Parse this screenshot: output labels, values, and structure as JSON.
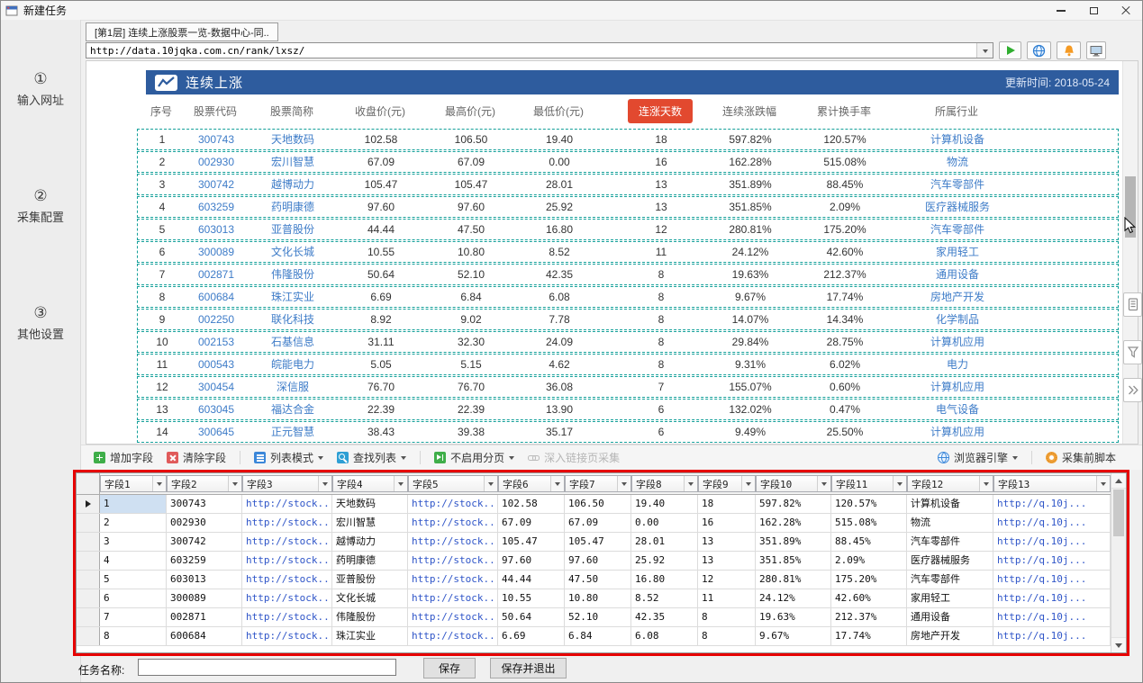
{
  "window": {
    "title": "新建任务"
  },
  "sidebar": {
    "steps": [
      {
        "num": "①",
        "label": "输入网址"
      },
      {
        "num": "②",
        "label": "采集配置"
      },
      {
        "num": "③",
        "label": "其他设置"
      }
    ]
  },
  "tab": {
    "label": "[第1层] 连续上涨股票一览-数据中心-同.."
  },
  "urlbar": {
    "url": "http://data.10jqka.com.cn/rank/lxsz/"
  },
  "browser": {
    "site_title": "连续上涨",
    "update_time": "更新时间: 2018-05-24",
    "table": {
      "headers": [
        "序号",
        "股票代码",
        "股票简称",
        "收盘价(元)",
        "最高价(元)",
        "最低价(元)",
        "连涨天数",
        "连续涨跌幅",
        "累计换手率",
        "所属行业"
      ],
      "rows": [
        [
          "1",
          "300743",
          "天地数码",
          "102.58",
          "106.50",
          "19.40",
          "18",
          "597.82%",
          "120.57%",
          "计算机设备"
        ],
        [
          "2",
          "002930",
          "宏川智慧",
          "67.09",
          "67.09",
          "0.00",
          "16",
          "162.28%",
          "515.08%",
          "物流"
        ],
        [
          "3",
          "300742",
          "越博动力",
          "105.47",
          "105.47",
          "28.01",
          "13",
          "351.89%",
          "88.45%",
          "汽车零部件"
        ],
        [
          "4",
          "603259",
          "药明康德",
          "97.60",
          "97.60",
          "25.92",
          "13",
          "351.85%",
          "2.09%",
          "医疗器械服务"
        ],
        [
          "5",
          "603013",
          "亚普股份",
          "44.44",
          "47.50",
          "16.80",
          "12",
          "280.81%",
          "175.20%",
          "汽车零部件"
        ],
        [
          "6",
          "300089",
          "文化长城",
          "10.55",
          "10.80",
          "8.52",
          "11",
          "24.12%",
          "42.60%",
          "家用轻工"
        ],
        [
          "7",
          "002871",
          "伟隆股份",
          "50.64",
          "52.10",
          "42.35",
          "8",
          "19.63%",
          "212.37%",
          "通用设备"
        ],
        [
          "8",
          "600684",
          "珠江实业",
          "6.69",
          "6.84",
          "6.08",
          "8",
          "9.67%",
          "17.74%",
          "房地产开发"
        ],
        [
          "9",
          "002250",
          "联化科技",
          "8.92",
          "9.02",
          "7.78",
          "8",
          "14.07%",
          "14.34%",
          "化学制品"
        ],
        [
          "10",
          "002153",
          "石基信息",
          "31.11",
          "32.30",
          "24.09",
          "8",
          "29.84%",
          "28.75%",
          "计算机应用"
        ],
        [
          "11",
          "000543",
          "皖能电力",
          "5.05",
          "5.15",
          "4.62",
          "8",
          "9.31%",
          "6.02%",
          "电力"
        ],
        [
          "12",
          "300454",
          "深信服",
          "76.70",
          "76.70",
          "36.08",
          "7",
          "155.07%",
          "0.60%",
          "计算机应用"
        ],
        [
          "13",
          "603045",
          "福达合金",
          "22.39",
          "22.39",
          "13.90",
          "6",
          "132.02%",
          "0.47%",
          "电气设备"
        ],
        [
          "14",
          "300645",
          "正元智慧",
          "38.43",
          "39.38",
          "35.17",
          "6",
          "9.49%",
          "25.50%",
          "计算机应用"
        ]
      ]
    }
  },
  "toolbar": {
    "left": [
      {
        "name": "add-field-button",
        "icon": "plus-icon",
        "label": "增加字段"
      },
      {
        "name": "clear-fields-button",
        "icon": "clear-icon",
        "label": "清除字段"
      },
      {
        "name": "list-mode-button",
        "icon": "list-mode-icon",
        "label": "列表模式",
        "dropdown": true
      },
      {
        "name": "find-list-button",
        "icon": "find-list-icon",
        "label": "查找列表",
        "dropdown": true
      },
      {
        "name": "pagination-mode-button",
        "icon": "pagination-icon",
        "label": "不启用分页",
        "dropdown": true
      },
      {
        "name": "deep-link-collect-button",
        "icon": "link-icon",
        "label": "深入链接页采集",
        "disabled": true
      }
    ],
    "right": [
      {
        "name": "browser-engine-button",
        "icon": "engine-globe-icon",
        "label": "浏览器引擎",
        "dropdown": true
      },
      {
        "name": "pre-collect-script-button",
        "icon": "script-icon",
        "label": "采集前脚本"
      }
    ]
  },
  "grid": {
    "headers": [
      "字段1",
      "字段2",
      "字段3",
      "字段4",
      "字段5",
      "字段6",
      "字段7",
      "字段8",
      "字段9",
      "字段10",
      "字段11",
      "字段12",
      "字段13"
    ],
    "rows": [
      [
        "1",
        "300743",
        "http://stock...",
        "天地数码",
        "http://stock...",
        "102.58",
        "106.50",
        "19.40",
        "18",
        "597.82%",
        "120.57%",
        "计算机设备",
        "http://q.10j..."
      ],
      [
        "2",
        "002930",
        "http://stock...",
        "宏川智慧",
        "http://stock...",
        "67.09",
        "67.09",
        "0.00",
        "16",
        "162.28%",
        "515.08%",
        "物流",
        "http://q.10j..."
      ],
      [
        "3",
        "300742",
        "http://stock...",
        "越博动力",
        "http://stock...",
        "105.47",
        "105.47",
        "28.01",
        "13",
        "351.89%",
        "88.45%",
        "汽车零部件",
        "http://q.10j..."
      ],
      [
        "4",
        "603259",
        "http://stock...",
        "药明康德",
        "http://stock...",
        "97.60",
        "97.60",
        "25.92",
        "13",
        "351.85%",
        "2.09%",
        "医疗器械服务",
        "http://q.10j..."
      ],
      [
        "5",
        "603013",
        "http://stock...",
        "亚普股份",
        "http://stock...",
        "44.44",
        "47.50",
        "16.80",
        "12",
        "280.81%",
        "175.20%",
        "汽车零部件",
        "http://q.10j..."
      ],
      [
        "6",
        "300089",
        "http://stock...",
        "文化长城",
        "http://stock...",
        "10.55",
        "10.80",
        "8.52",
        "11",
        "24.12%",
        "42.60%",
        "家用轻工",
        "http://q.10j..."
      ],
      [
        "7",
        "002871",
        "http://stock...",
        "伟隆股份",
        "http://stock...",
        "50.64",
        "52.10",
        "42.35",
        "8",
        "19.63%",
        "212.37%",
        "通用设备",
        "http://q.10j..."
      ],
      [
        "8",
        "600684",
        "http://stock...",
        "珠江实业",
        "http://stock...",
        "6.69",
        "6.84",
        "6.08",
        "8",
        "9.67%",
        "17.74%",
        "房地产开发",
        "http://q.10j..."
      ]
    ]
  },
  "footer": {
    "task_label": "任务名称:",
    "save": "保存",
    "save_exit": "保存并退出"
  },
  "colors": {
    "accent_blue": "#2e5c9e",
    "badge_red": "#e2492f",
    "link_blue": "#3e7cc8",
    "dash_teal": "#14a09a",
    "frame_red": "#e60000"
  },
  "icons": {
    "close": "×",
    "minimize": "—",
    "maximize": "□",
    "dropdown": "▼",
    "play": "▶",
    "current_row_marker": "▶",
    "scroll_up": "▲",
    "scroll_down": "▼"
  }
}
